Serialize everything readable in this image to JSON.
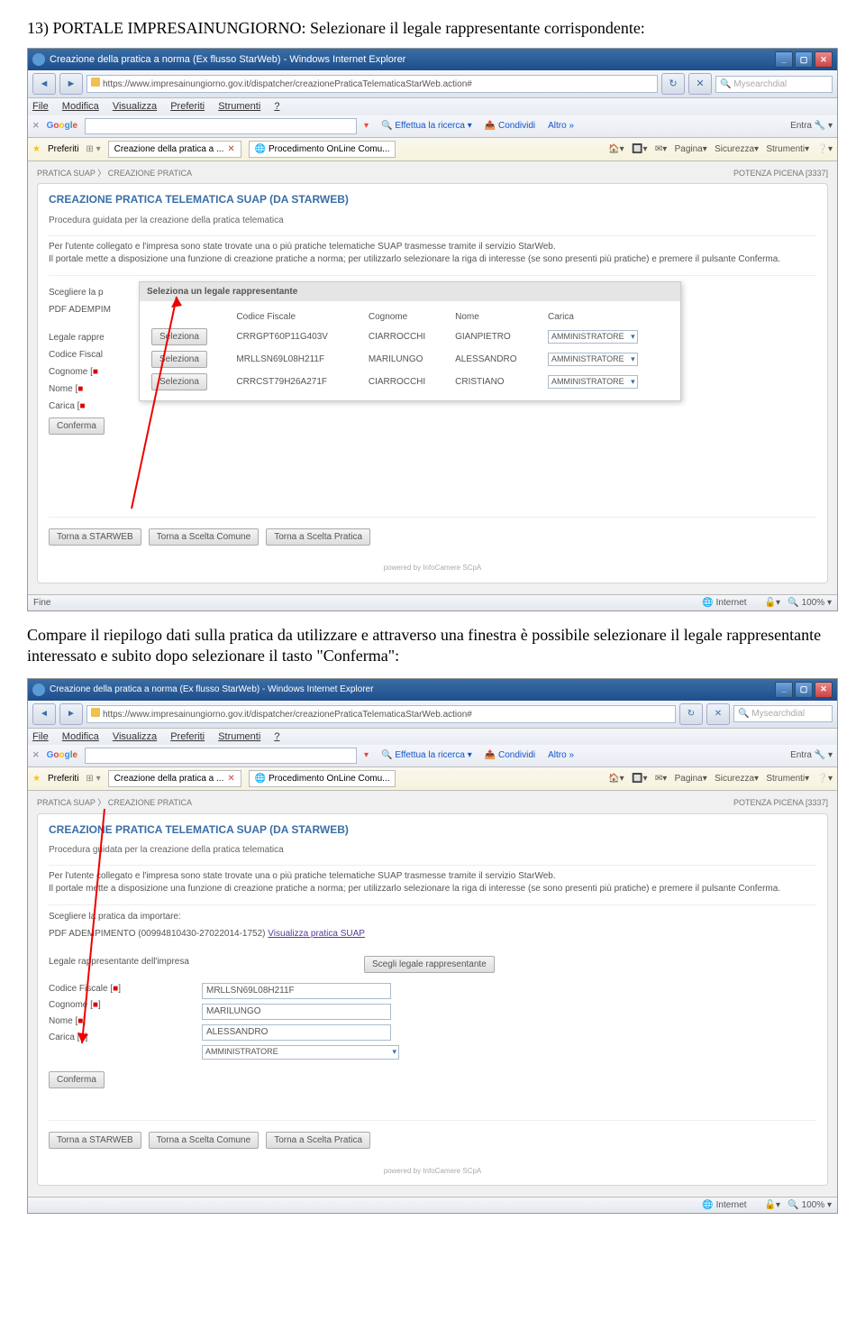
{
  "step13": "13) PORTALE IMPRESAINUNGIORNO: Selezionare il legale rappresentante corrispondente:",
  "bodytext": "Compare il riepilogo dati sulla pratica da utilizzare e attraverso una finestra è possibile selezionare il legale rappresentante interessato e subito dopo selezionare il tasto \"Conferma\":",
  "s1": {
    "title": "Creazione della pratica a norma (Ex flusso StarWeb) - Windows Internet Explorer",
    "url": "https://www.impresainungiorno.gov.it/dispatcher/creazionePraticaTelematicaStarWeb.action#",
    "searchph": "Mysearchdial",
    "menu": {
      "file": "File",
      "mod": "Modifica",
      "vis": "Visualizza",
      "pref": "Preferiti",
      "str": "Strumenti",
      "q": "?"
    },
    "google": {
      "ricerca": "Effettua la ricerca",
      "cond": "Condividi",
      "altro": "Altro »",
      "entra": "Entra"
    },
    "fav": {
      "pref": "Preferiti",
      "tab1": "Creazione della pratica a ...",
      "tab2": "Procedimento OnLine Comu...",
      "pagina": "Pagina",
      "sic": "Sicurezza",
      "stru": "Strumenti"
    },
    "bc1": "PRATICA SUAP",
    "bc2": "CREAZIONE PRATICA",
    "loc": "POTENZA PICENA  [3337]",
    "ptitle": "CREAZIONE PRATICA TELEMATICA SUAP (DA STARWEB)",
    "psub": "Procedura guidata per la creazione della pratica telematica",
    "desc": "Per l'utente collegato e l'impresa sono state trovate una o più pratiche telematiche SUAP trasmesse tramite il servizio StarWeb.\nIl portale mette a disposizione una funzione di creazione pratiche a norma; per utilizzarlo selezionare la riga di interesse (se sono presenti più pratiche) e premere il pulsante Conferma.",
    "form": {
      "scegli": "Scegliere la p",
      "pdf": "PDF ADEMPIM",
      "legale": "Legale rappre",
      "cf": "Codice Fiscal",
      "cog": "Cognome [",
      "nome": "Nome [",
      "carica": "Carica [",
      "conf": "Conferma"
    },
    "modal": {
      "title": "Seleziona un legale rappresentante",
      "hcf": "Codice Fiscale",
      "hcog": "Cognome",
      "hnome": "Nome",
      "hcar": "Carica",
      "sel": "Seleziona",
      "r1": {
        "cf": "CRRGPT60P11G403V",
        "cog": "CIARROCCHI",
        "nome": "GIANPIETRO",
        "car": "AMMINISTRATORE"
      },
      "r2": {
        "cf": "MRLLSN69L08H211F",
        "cog": "MARILUNGO",
        "nome": "ALESSANDRO",
        "car": "AMMINISTRATORE"
      },
      "r3": {
        "cf": "CRRCST79H26A271F",
        "cog": "CIARROCCHI",
        "nome": "CRISTIANO",
        "car": "AMMINISTRATORE"
      }
    },
    "b1": "Torna a STARWEB",
    "b2": "Torna a Scelta Comune",
    "b3": "Torna a Scelta Pratica",
    "pow": "powered by InfoCamere SCpA",
    "status": "Fine",
    "net": "Internet",
    "zoom": "100%"
  },
  "s2": {
    "title": "Creazione della pratica a norma (Ex flusso StarWeb) - Windows Internet Explorer",
    "url": "https://www.impresainungiorno.gov.it/dispatcher/creazionePraticaTelematicaStarWeb.action#",
    "searchph": "Mysearchdial",
    "ptitle": "CREAZIONE PRATICA TELEMATICA SUAP (DA STARWEB)",
    "psub": "Procedura guidata per la creazione della pratica telematica",
    "desc": "Per l'utente collegato e l'impresa sono state trovate una o più pratiche telematiche SUAP trasmesse tramite il servizio StarWeb.\nIl portale mette a disposizione una funzione di creazione pratiche a norma; per utilizzarlo selezionare la riga di interesse (se sono presenti più pratiche) e premere il pulsante Conferma.",
    "scegli": "Scegliere la pratica da importare:",
    "pdf": "PDF ADEMPIMENTO (00994810430-27022014-1752)",
    "vlink": "Visualizza pratica SUAP",
    "leg": "Legale rappresentante dell'impresa",
    "btnscegli": "Scegli legale rappresentante",
    "lcf": "Codice Fiscale [",
    "lcog": "Cognome [",
    "lnome": "Nome [",
    "lcar": "Carica [",
    "vcf": "MRLLSN69L08H211F",
    "vcog": "MARILUNGO",
    "vnome": "ALESSANDRO",
    "vcar": "AMMINISTRATORE",
    "conf": "Conferma",
    "b1": "Torna a STARWEB",
    "b2": "Torna a Scelta Comune",
    "b3": "Torna a Scelta Pratica",
    "net": "Internet",
    "zoom": "100%"
  }
}
